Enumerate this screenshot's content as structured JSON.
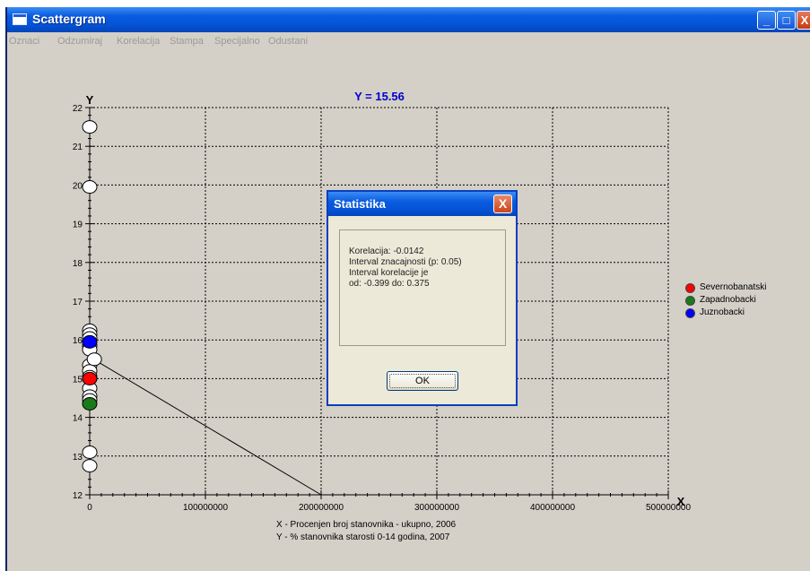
{
  "window": {
    "title": "Scattergram",
    "controls": {
      "minimize": "_",
      "maximize": "□",
      "close": "X"
    }
  },
  "menu": {
    "items": [
      "Oznaci",
      "Odzumiraj",
      "Korelacija",
      "Stampa",
      "Specijalno",
      "Odustani"
    ]
  },
  "chart_data": {
    "type": "scatter",
    "title": "Y = 15.56",
    "xlabel": "X",
    "ylabel": "Y",
    "xlim": [
      0,
      500000000
    ],
    "ylim": [
      12,
      22
    ],
    "x_ticks": [
      "0",
      "100000000",
      "200000000",
      "300000000",
      "400000000",
      "500000000"
    ],
    "y_ticks": [
      "12",
      "13",
      "14",
      "15",
      "16",
      "17",
      "18",
      "19",
      "20",
      "21",
      "22"
    ],
    "grid": true,
    "legend_position": "right",
    "series": [
      {
        "name": "Severnobanatski",
        "color": "#ff0000",
        "points": [
          [
            0,
            15.0
          ]
        ]
      },
      {
        "name": "Zapadnobacki",
        "color": "#1a7a1a",
        "points": [
          [
            0,
            14.35
          ]
        ]
      },
      {
        "name": "Juznobacki",
        "color": "#0000ff",
        "points": [
          [
            0,
            15.95
          ]
        ]
      },
      {
        "color": "#ffffff",
        "points": [
          [
            0,
            21.5
          ],
          [
            0,
            19.95
          ],
          [
            0,
            16.25
          ],
          [
            0,
            16.15
          ],
          [
            0,
            16.05
          ],
          [
            0,
            15.85
          ],
          [
            0,
            15.75
          ],
          [
            0,
            15.35
          ],
          [
            0,
            15.2
          ],
          [
            0,
            15.05
          ],
          [
            0,
            14.75
          ],
          [
            0,
            14.55
          ],
          [
            0,
            14.45
          ],
          [
            0,
            13.1
          ],
          [
            0,
            12.75
          ],
          [
            4000000,
            15.5
          ]
        ]
      }
    ],
    "regression_line": [
      [
        0,
        15.56
      ],
      [
        200000000,
        12
      ]
    ]
  },
  "axis_captions": {
    "x": "X -   Procenjen broj stanovnika - ukupno, 2006",
    "y": "Y -   % stanovnika starosti 0-14 godina, 2007"
  },
  "dialog": {
    "title": "Statistika",
    "close": "X",
    "lines": [
      "Korelacija:  -0.0142",
      "Interval znacajnosti (p: 0.05)",
      "Interval korelacije je",
      "od: -0.399 do: 0.375"
    ],
    "ok_label": "OK"
  }
}
